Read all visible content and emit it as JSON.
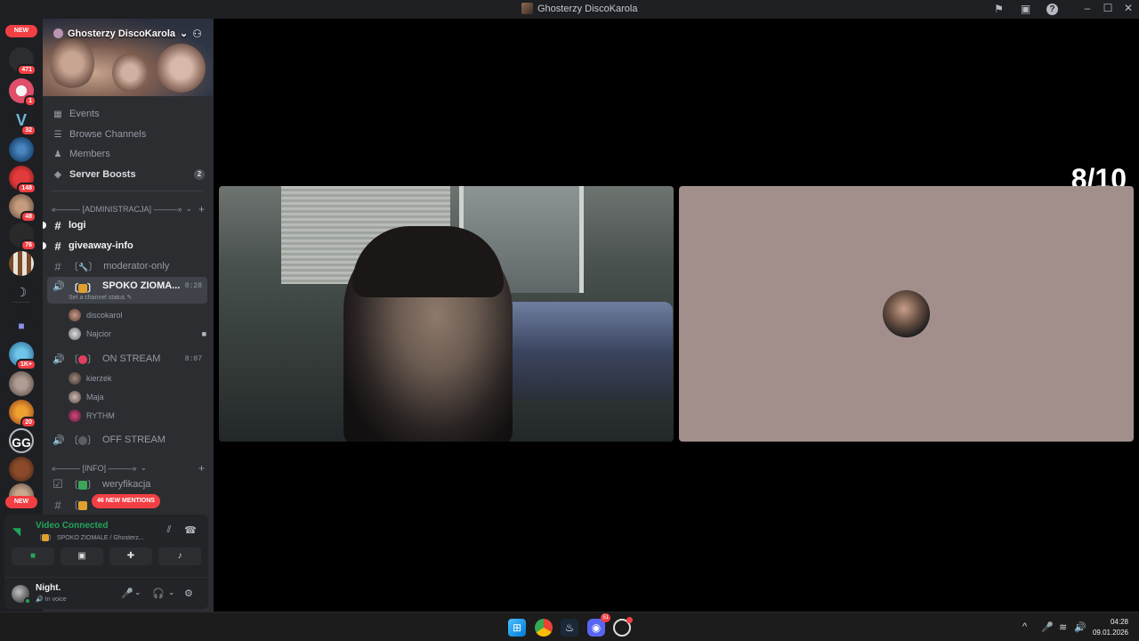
{
  "window": {
    "title": "Ghosterzy DiscoKarola"
  },
  "guilds": {
    "new_top": "NEW",
    "new_bottom": "NEW",
    "badges": [
      "471",
      "1",
      "32",
      "148",
      "48",
      "76",
      "1K+",
      "20"
    ]
  },
  "server": {
    "name": "Ghosterzy DiscoKarola"
  },
  "menu": {
    "events": "Events",
    "browse": "Browse Channels",
    "members": "Members",
    "boosts": "Server Boosts",
    "boosts_count": "2"
  },
  "categories": {
    "admin": "«——— [ADMINISTRACJA] ———»",
    "info": "«——— [INFO] ———»"
  },
  "channels": {
    "logi": "logi",
    "giveaway": "giveaway-info",
    "moderator": "moderator-only",
    "spoko": "SPOKO ZIOMA...",
    "spoko_time": "8:28",
    "spoko_status": "Set a channel status",
    "onstream": "ON STREAM",
    "onstream_time": "8:07",
    "offstream": "OFF STREAM",
    "weryfikacja": "weryfikacja"
  },
  "voice_users": {
    "spoko": [
      "discokarol",
      "Najcior"
    ],
    "onstream": [
      "kierzek",
      "Maja",
      "RYTHM"
    ]
  },
  "mentions": "46 NEW MENTIONS",
  "voice_panel": {
    "title": "Video Connected",
    "subtitle": "SPOKO ZIOMALE / Ghosterz..."
  },
  "user_panel": {
    "name": "Night.",
    "status": "In voice"
  },
  "stage": {
    "rating": "8/10"
  },
  "taskbar": {
    "time": "04:28",
    "date": "09.01.2026",
    "discord_badge": "51"
  },
  "icons": {
    "events": "calendar-icon",
    "browse": "list-icon",
    "members": "people-icon",
    "boosts": "boost-shield-icon",
    "settings": "gear-icon"
  }
}
